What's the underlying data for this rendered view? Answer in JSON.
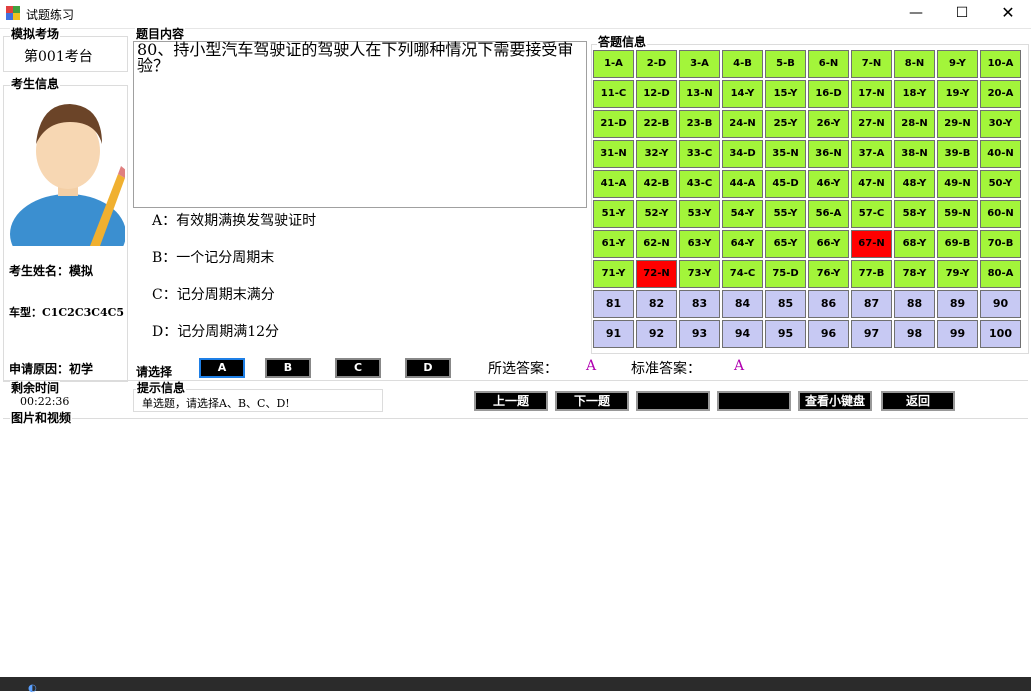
{
  "window": {
    "title": "试题练习",
    "min_glyph": "—",
    "max_glyph": "☐",
    "close_glyph": "✕"
  },
  "exam_site": {
    "title": "模拟考场",
    "value": "第001考台"
  },
  "examinee": {
    "title": "考生信息",
    "name_label": "考生姓名：模拟",
    "car_label": "车型：C1C2C3C4C5",
    "reason_label": "申请原因：初学"
  },
  "timer": {
    "title": "剩余时间",
    "value": "00:22:36"
  },
  "question": {
    "title": "题目内容",
    "text": "80、持小型汽车驾驶证的驾驶人在下列哪种情况下需要接受审验？",
    "options": [
      "A：有效期满换发驾驶证时",
      "B：一个记分周期末",
      "C：记分周期末满分",
      "D：记分周期满12分"
    ]
  },
  "selection": {
    "label": "请选择",
    "buttons": [
      "A",
      "B",
      "C",
      "D"
    ],
    "chosen_label": "所选答案：",
    "chosen_value": "A",
    "standard_label": "标准答案：",
    "standard_value": "A"
  },
  "hint": {
    "title": "提示信息",
    "text": "单选题，请选择A、B、C、D!"
  },
  "actions": {
    "prev": "上一题",
    "next": "下一题",
    "blank1": "",
    "blank2": "",
    "board": "查看小键盘",
    "back": "返回"
  },
  "media": {
    "title": "图片和视频"
  },
  "answer_panel": {
    "title": "答题信息",
    "colors": {
      "answered": "#a3f53a",
      "wrong": "#ff0000",
      "unanswered": "#c7c9f3"
    },
    "cells": [
      {
        "text": "1-A",
        "state": "done"
      },
      {
        "text": "2-D",
        "state": "done"
      },
      {
        "text": "3-A",
        "state": "done"
      },
      {
        "text": "4-B",
        "state": "done"
      },
      {
        "text": "5-B",
        "state": "done"
      },
      {
        "text": "6-N",
        "state": "done"
      },
      {
        "text": "7-N",
        "state": "done"
      },
      {
        "text": "8-N",
        "state": "done"
      },
      {
        "text": "9-Y",
        "state": "done"
      },
      {
        "text": "10-A",
        "state": "done"
      },
      {
        "text": "11-C",
        "state": "done"
      },
      {
        "text": "12-D",
        "state": "done"
      },
      {
        "text": "13-N",
        "state": "done"
      },
      {
        "text": "14-Y",
        "state": "done"
      },
      {
        "text": "15-Y",
        "state": "done"
      },
      {
        "text": "16-D",
        "state": "done"
      },
      {
        "text": "17-N",
        "state": "done"
      },
      {
        "text": "18-Y",
        "state": "done"
      },
      {
        "text": "19-Y",
        "state": "done"
      },
      {
        "text": "20-A",
        "state": "done"
      },
      {
        "text": "21-D",
        "state": "done"
      },
      {
        "text": "22-B",
        "state": "done"
      },
      {
        "text": "23-B",
        "state": "done"
      },
      {
        "text": "24-N",
        "state": "done"
      },
      {
        "text": "25-Y",
        "state": "done"
      },
      {
        "text": "26-Y",
        "state": "done"
      },
      {
        "text": "27-N",
        "state": "done"
      },
      {
        "text": "28-N",
        "state": "done"
      },
      {
        "text": "29-N",
        "state": "done"
      },
      {
        "text": "30-Y",
        "state": "done"
      },
      {
        "text": "31-N",
        "state": "done"
      },
      {
        "text": "32-Y",
        "state": "done"
      },
      {
        "text": "33-C",
        "state": "done"
      },
      {
        "text": "34-D",
        "state": "done"
      },
      {
        "text": "35-N",
        "state": "done"
      },
      {
        "text": "36-N",
        "state": "done"
      },
      {
        "text": "37-A",
        "state": "done"
      },
      {
        "text": "38-N",
        "state": "done"
      },
      {
        "text": "39-B",
        "state": "done"
      },
      {
        "text": "40-N",
        "state": "done"
      },
      {
        "text": "41-A",
        "state": "done"
      },
      {
        "text": "42-B",
        "state": "done"
      },
      {
        "text": "43-C",
        "state": "done"
      },
      {
        "text": "44-A",
        "state": "done"
      },
      {
        "text": "45-D",
        "state": "done"
      },
      {
        "text": "46-Y",
        "state": "done"
      },
      {
        "text": "47-N",
        "state": "done"
      },
      {
        "text": "48-Y",
        "state": "done"
      },
      {
        "text": "49-N",
        "state": "done"
      },
      {
        "text": "50-Y",
        "state": "done"
      },
      {
        "text": "51-Y",
        "state": "done"
      },
      {
        "text": "52-Y",
        "state": "done"
      },
      {
        "text": "53-Y",
        "state": "done"
      },
      {
        "text": "54-Y",
        "state": "done"
      },
      {
        "text": "55-Y",
        "state": "done"
      },
      {
        "text": "56-A",
        "state": "done"
      },
      {
        "text": "57-C",
        "state": "done"
      },
      {
        "text": "58-Y",
        "state": "done"
      },
      {
        "text": "59-N",
        "state": "done"
      },
      {
        "text": "60-N",
        "state": "done"
      },
      {
        "text": "61-Y",
        "state": "done"
      },
      {
        "text": "62-N",
        "state": "done"
      },
      {
        "text": "63-Y",
        "state": "done"
      },
      {
        "text": "64-Y",
        "state": "done"
      },
      {
        "text": "65-Y",
        "state": "done"
      },
      {
        "text": "66-Y",
        "state": "done"
      },
      {
        "text": "67-N",
        "state": "wrong"
      },
      {
        "text": "68-Y",
        "state": "done"
      },
      {
        "text": "69-B",
        "state": "done"
      },
      {
        "text": "70-B",
        "state": "done"
      },
      {
        "text": "71-Y",
        "state": "done"
      },
      {
        "text": "72-N",
        "state": "wrong"
      },
      {
        "text": "73-Y",
        "state": "done"
      },
      {
        "text": "74-C",
        "state": "done"
      },
      {
        "text": "75-D",
        "state": "done"
      },
      {
        "text": "76-Y",
        "state": "done"
      },
      {
        "text": "77-B",
        "state": "done"
      },
      {
        "text": "78-Y",
        "state": "done"
      },
      {
        "text": "79-Y",
        "state": "done"
      },
      {
        "text": "80-A",
        "state": "done"
      },
      {
        "text": "81",
        "state": "empty"
      },
      {
        "text": "82",
        "state": "empty"
      },
      {
        "text": "83",
        "state": "empty"
      },
      {
        "text": "84",
        "state": "empty"
      },
      {
        "text": "85",
        "state": "empty"
      },
      {
        "text": "86",
        "state": "empty"
      },
      {
        "text": "87",
        "state": "empty"
      },
      {
        "text": "88",
        "state": "empty"
      },
      {
        "text": "89",
        "state": "empty"
      },
      {
        "text": "90",
        "state": "empty"
      },
      {
        "text": "91",
        "state": "empty"
      },
      {
        "text": "92",
        "state": "empty"
      },
      {
        "text": "93",
        "state": "empty"
      },
      {
        "text": "94",
        "state": "empty"
      },
      {
        "text": "95",
        "state": "empty"
      },
      {
        "text": "96",
        "state": "empty"
      },
      {
        "text": "97",
        "state": "empty"
      },
      {
        "text": "98",
        "state": "empty"
      },
      {
        "text": "99",
        "state": "empty"
      },
      {
        "text": "100",
        "state": "empty"
      }
    ]
  }
}
